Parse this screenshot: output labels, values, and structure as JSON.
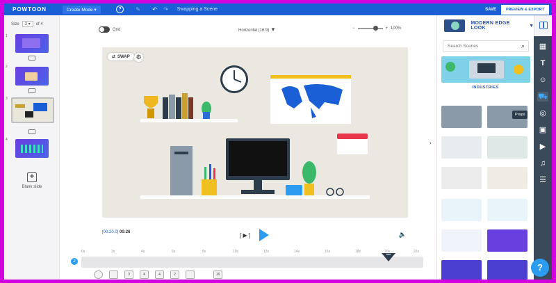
{
  "colors": {
    "topbar": "#1a5fd6",
    "accent": "#2b9cf0",
    "frame": "#d200e0",
    "rail": "#3a4a5a"
  },
  "topbar": {
    "logo": "POWTOON",
    "mode": "Create Mode ▾",
    "scene_title": "Swapping a Scene",
    "save": "SAVE",
    "preview": "PREVIEW & EXPORT",
    "icons": [
      "help-icon",
      "pen-icon",
      "undo-icon",
      "redo-icon"
    ]
  },
  "slides": {
    "size_label": "Size",
    "size_value": "3",
    "of_label": "of 4",
    "items": [
      {
        "num": "1"
      },
      {
        "num": "2"
      },
      {
        "num": "3"
      },
      {
        "num": "4"
      }
    ],
    "blank_label": "Blank slide"
  },
  "canvas": {
    "grid_label": "Grid",
    "aspect": "Horizontal (16:9)",
    "zoom": "100%",
    "swap_label": "SWAP"
  },
  "playback": {
    "time_current": "[00:20.0]",
    "time_total": "00:26",
    "frame_label": "[ ▶ ]"
  },
  "timeline": {
    "ticks": [
      "0s",
      "2s",
      "4s",
      "6s",
      "8s",
      "10s",
      "12s",
      "14s",
      "16s",
      "18s",
      "20s",
      "22s"
    ],
    "start_label": "2",
    "marker": "•••",
    "items": [
      "",
      "",
      "3",
      "4",
      "4",
      "2",
      "",
      "16"
    ]
  },
  "right_panel": {
    "style_name": "MODERN EDGE LOOK",
    "search_placeholder": "Search Scenes",
    "category": "INDUSTRIES",
    "tooltip": "Props"
  }
}
